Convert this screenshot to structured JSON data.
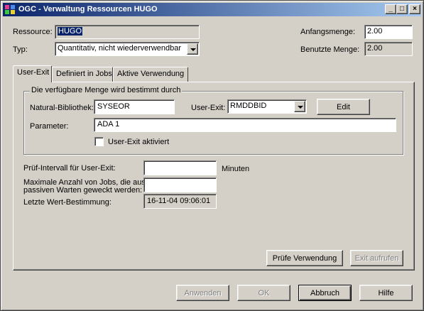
{
  "window": {
    "title": "OGC - Verwaltung Ressourcen HUGO",
    "controls": {
      "minimize": "_",
      "maximize": "□",
      "close": "×"
    }
  },
  "resource": {
    "label": "Ressource:",
    "value": "HUGO",
    "type_label": "Typ:",
    "type_value": "Quantitativ, nicht wiederverwendbar",
    "initial_qty_label": "Anfangsmenge:",
    "initial_qty_value": "2.00",
    "used_qty_label": "Benutzte Menge:",
    "used_qty_value": "2.00"
  },
  "tabs": [
    {
      "label": "User-Exit",
      "active": true
    },
    {
      "label": "Definiert in Jobs",
      "active": false
    },
    {
      "label": "Aktive Verwendung",
      "active": false
    }
  ],
  "user_exit": {
    "group_title": "Die verfügbare Menge wird bestimmt durch",
    "library_label": "Natural-Bibliothek:",
    "library_value": "SYSEOR",
    "exit_label": "User-Exit:",
    "exit_value": "RMDDBID",
    "edit_button": "Edit",
    "param_label": "Parameter:",
    "param_value": "ADA 1",
    "activated_label": "User-Exit aktiviert",
    "activated_checked": false,
    "interval_label": "Prüf-Intervall für User-Exit:",
    "interval_value": "",
    "interval_unit": "Minuten",
    "max_jobs_label_1": "Maximale Anzahl von Jobs, die aus",
    "max_jobs_label_2": "passiven Warten geweckt werden:",
    "max_jobs_value": "",
    "last_eval_label": "Letzte Wert-Bestimmung:",
    "last_eval_value": "16-11-04 09:06:01",
    "check_usage_button": "Prüfe Verwendung",
    "call_exit_button": "Exit aufrufen"
  },
  "footer": {
    "apply": "Anwenden",
    "ok": "OK",
    "cancel": "Abbruch",
    "help": "Hilfe"
  }
}
